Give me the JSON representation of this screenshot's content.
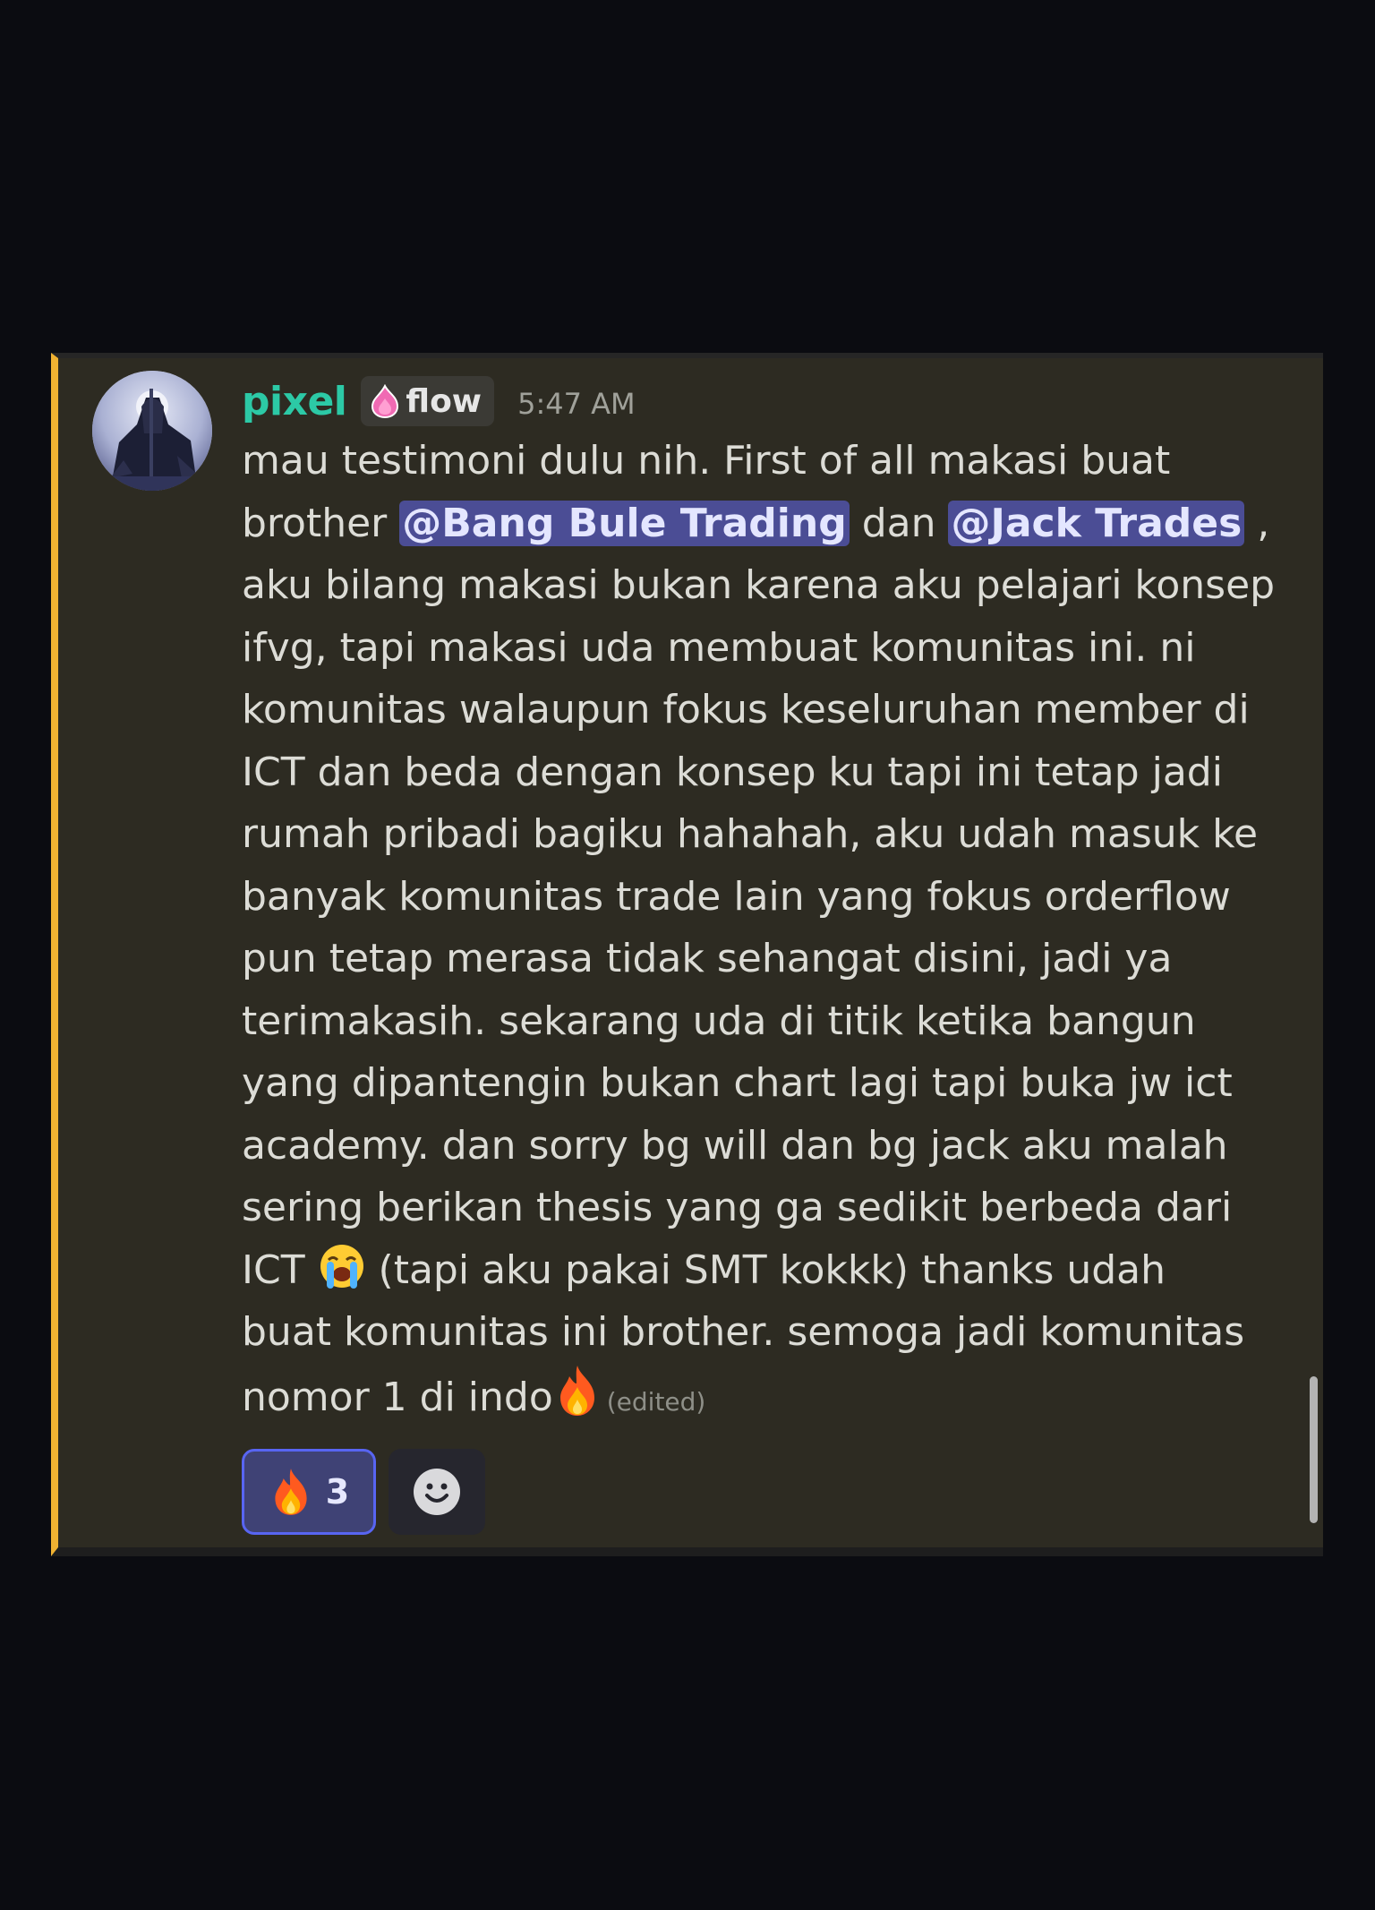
{
  "message": {
    "username": "pixel",
    "tag_label": "flow",
    "tag_icon": "pink-flame-icon",
    "timestamp": "5:47 AM",
    "lines": {
      "l1": "mau testimoni dulu nih. First of all makasi buat",
      "l2_pre": "brother ",
      "mention1": "@Bang Bule Trading",
      "l2_mid": " dan ",
      "mention2": "@Jack Trades",
      "l2_post": " ,",
      "l3": "aku bilang makasi bukan karena aku pelajari konsep",
      "l4": "ifvg, tapi makasi uda membuat komunitas ini. ni",
      "l5": "komunitas walaupun fokus keseluruhan member di",
      "l6": "ICT dan beda dengan konsep ku tapi ini tetap jadi",
      "l7": "rumah pribadi bagiku hahahah, aku udah masuk ke",
      "l8": "banyak komunitas trade lain yang fokus orderflow",
      "l9": "pun tetap merasa tidak sehangat disini, jadi ya",
      "l10": "terimakasih. sekarang uda di titik ketika bangun",
      "l11": "yang dipantengin bukan chart lagi tapi buka jw ict",
      "l12": "academy. dan sorry bg will dan bg jack aku malah",
      "l13": "sering berikan thesis yang ga sedikit berbeda dari",
      "l14_pre": "ICT ",
      "l14_post": " (tapi aku pakai SMT kokkk)  thanks udah",
      "l15": "buat komunitas ini brother. semoga jadi komunitas",
      "l16": "nomor 1 di indo"
    },
    "emojis": {
      "crying": "loudly-crying-face-icon",
      "fire": "fire-icon"
    },
    "edited_label": "(edited)",
    "reactions": [
      {
        "emoji": "fire-icon",
        "count": "3",
        "active": true
      }
    ],
    "add_reaction_icon": "smiley-add-reaction-icon"
  },
  "colors": {
    "accent_border": "#f0b232",
    "username": "#2cc9a6",
    "mention_bg": "#4b4d95",
    "reaction_border": "#5865f2",
    "background": "#0b0c11",
    "card": "#2d2b22"
  }
}
